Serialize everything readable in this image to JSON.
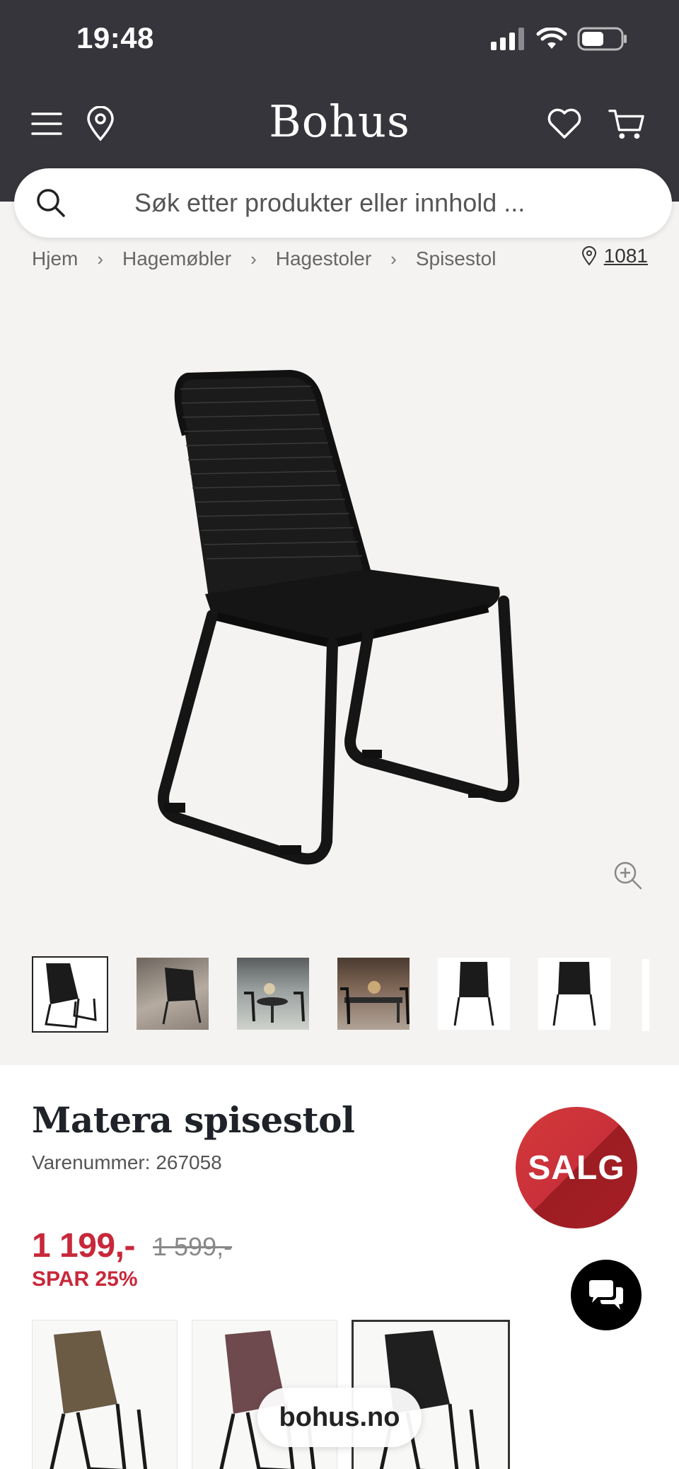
{
  "status_bar": {
    "time": "19:48"
  },
  "header": {
    "logo": "Bohus"
  },
  "search": {
    "placeholder": "Søk etter produkter eller innhold ..."
  },
  "breadcrumbs": [
    "Hjem",
    "Hagemøbler",
    "Hagestoler",
    "Spisestol"
  ],
  "location": {
    "zip": "1081"
  },
  "gallery": {
    "thumbnails": [
      "chair-black-front",
      "chair-on-deck",
      "terrace-set",
      "dining-set",
      "chair-front",
      "chair-back"
    ],
    "selected_index": 0
  },
  "product": {
    "title": "Matera spisestol",
    "sku": "Varenummer: 267058",
    "badge": "SALG",
    "price": "1 199,-",
    "old_price": "1 599,-",
    "save": "SPAR 25%"
  },
  "variants": [
    {
      "color": "#6b5a44"
    },
    {
      "color": "#6e4a4e"
    },
    {
      "color": "#1f1f1f"
    }
  ],
  "footer": {
    "site": "bohus.no"
  },
  "colors": {
    "header_bg": "#35353b",
    "sale_red": "#c8283a"
  }
}
